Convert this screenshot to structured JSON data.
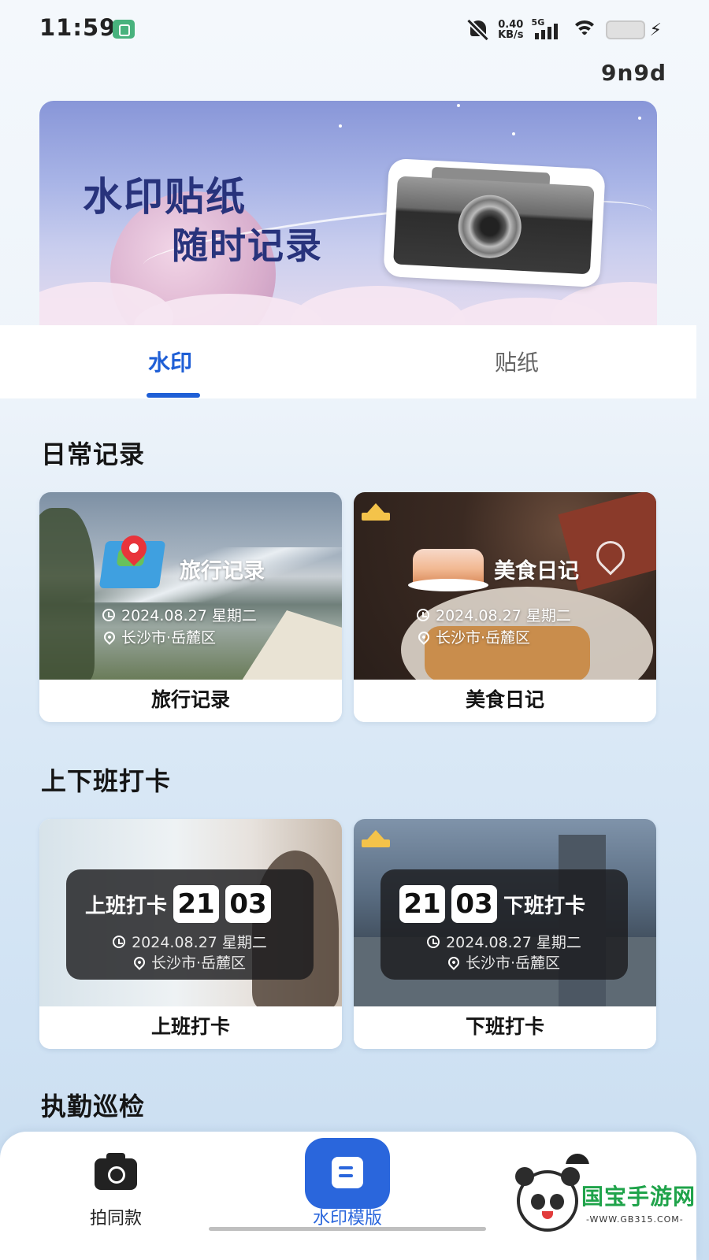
{
  "status_bar": {
    "time": "11:59",
    "net_speed_value": "0.40",
    "net_speed_unit": "KB/s",
    "network_type": "5G"
  },
  "header": {
    "brand_text": "9n9d"
  },
  "banner": {
    "title_line1": "水印贴纸",
    "title_line2": "随时记录"
  },
  "tabs": [
    {
      "label": "水印",
      "active": true
    },
    {
      "label": "贴纸",
      "active": false
    }
  ],
  "sections": [
    {
      "title": "日常记录",
      "cards": [
        {
          "label": "旅行记录",
          "overlay_title": "旅行记录",
          "date": "2024.08.27 星期二",
          "location": "长沙市·岳麓区",
          "premium": false
        },
        {
          "label": "美食日记",
          "overlay_title": "美食日记",
          "date": "2024.08.27 星期二",
          "location": "长沙市·岳麓区",
          "premium": true
        }
      ]
    },
    {
      "title": "上下班打卡",
      "cards": [
        {
          "label": "上班打卡",
          "overlay_title": "上班打卡",
          "hour": "21",
          "minute": "03",
          "date": "2024.08.27 星期二",
          "location": "长沙市·岳麓区",
          "premium": false
        },
        {
          "label": "下班打卡",
          "overlay_title": "下班打卡",
          "hour": "21",
          "minute": "03",
          "date": "2024.08.27 星期二",
          "location": "长沙市·岳麓区",
          "premium": true
        }
      ]
    },
    {
      "title": "执勤巡检"
    }
  ],
  "bottom_nav": [
    {
      "label": "拍同款",
      "icon": "camera-icon"
    },
    {
      "label": "水印模版",
      "icon": "template-icon",
      "active": true
    }
  ],
  "site_watermark": {
    "name": "国宝手游网",
    "url": "-WWW.GB315.COM-"
  },
  "colors": {
    "accent": "#1f5fd6",
    "nav_active": "#2a66dc",
    "premium_crown": "#f4c34a"
  }
}
